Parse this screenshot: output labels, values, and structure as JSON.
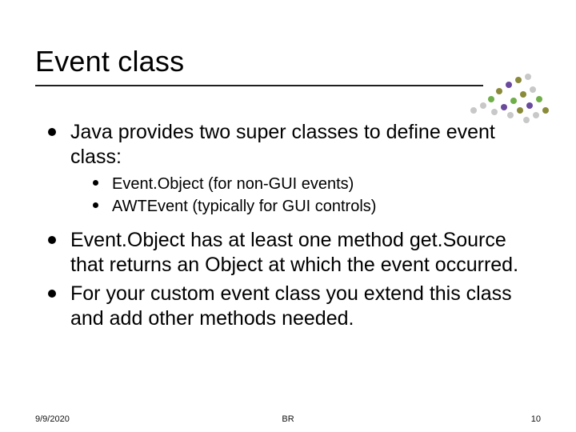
{
  "title": "Event class",
  "bullets": {
    "b1": "Java provides two super classes to define event class:",
    "sub": {
      "s1": "Event.Object (for non-GUI events)",
      "s2": "AWTEvent (typically for GUI controls)"
    },
    "b2": "Event.Object has at least one method get.Source that returns an Object at which the event occurred.",
    "b3": "For your custom event class you extend this class and add other methods needed."
  },
  "footer": {
    "date": "9/9/2020",
    "center": "BR",
    "page": "10"
  },
  "deco_colors": {
    "olive": "#8a8a3a",
    "green": "#6fae4a",
    "purple": "#6a4a9c",
    "grey": "#c8c8c8"
  }
}
